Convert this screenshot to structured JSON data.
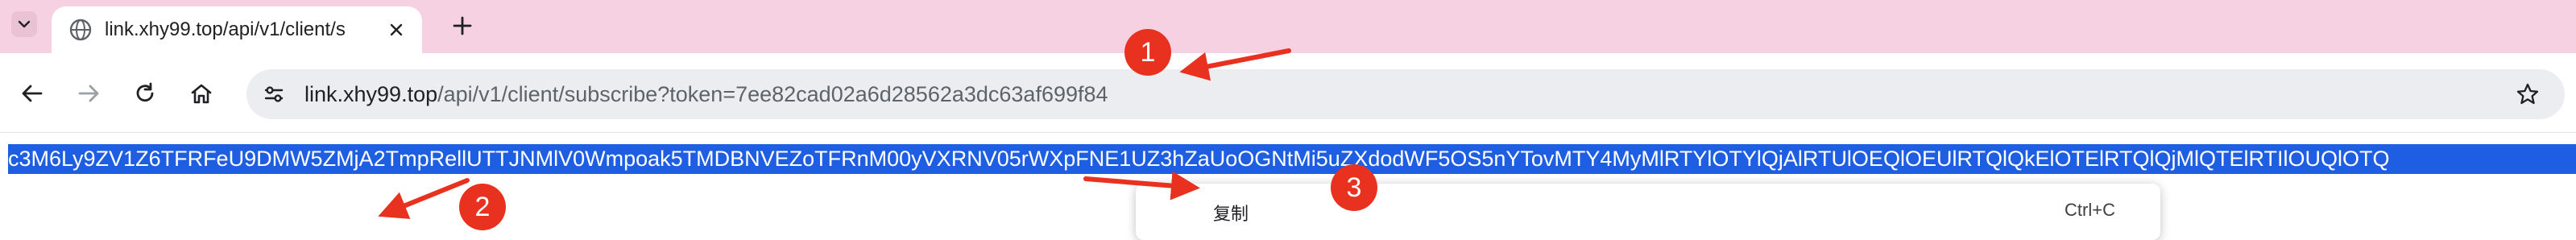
{
  "browser": {
    "tab": {
      "title": "link.xhy99.top/api/v1/client/s",
      "favicon": "globe-icon"
    },
    "address_bar": {
      "host": "link.xhy99.top",
      "path": "/api/v1/client/subscribe?token=7ee82cad02a6d28562a3dc63af699f84"
    }
  },
  "page": {
    "selected_text": "c3M6Ly9ZV1Z6TFRFeU9DMW5ZMjA2TmpRellUTTJNMlV0Wmpoak5TMDBNVEZoTFRnM00yVXRNV05rWXpFNE1UZ3hZaUoOGNtMi5uZXdodWF5OS5nYTovMTY4MyMlRTYlOTYlQjAlRTUlOEQlOEUlRTQlQkElOTElRTQlQjMlQTElRTIlOUQlOTQ"
  },
  "context_menu": {
    "items": [
      {
        "label": "复制",
        "shortcut": "Ctrl+C"
      }
    ]
  },
  "annotations": {
    "badges": [
      "1",
      "2",
      "3"
    ],
    "color": "#e8321f"
  },
  "colors": {
    "tabbar": "#f6d1e2",
    "selection": "#1e5ee3",
    "omnibox": "#ecedf0"
  }
}
